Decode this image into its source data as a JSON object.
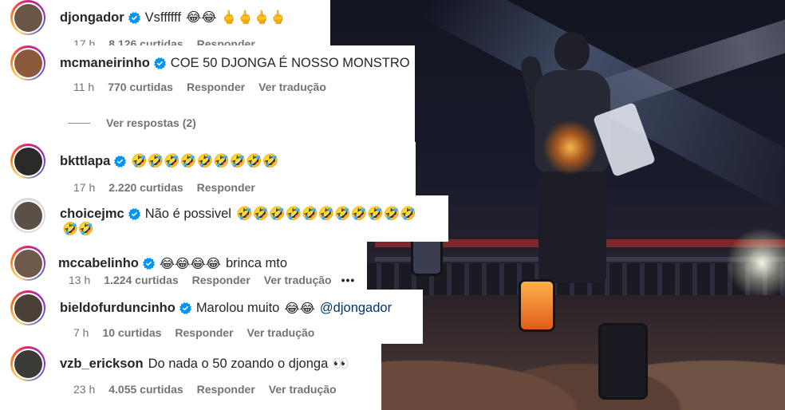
{
  "labels": {
    "reply": "Responder",
    "translate": "Ver tradução"
  },
  "comments": [
    {
      "username": "djongador",
      "text": "Vsffffff",
      "emojis": "😂😂 🖕🖕🖕🖕",
      "time": "17 h",
      "likes": "8.126 curtidas",
      "avatar_color": "#6b5646"
    },
    {
      "username": "mcmaneirinho",
      "text": "COE 50 DJONGA É NOSSO MONSTRO",
      "time": "11 h",
      "likes": "770 curtidas",
      "view_replies": "Ver respostas (2)",
      "avatar_color": "#8a5a3a"
    },
    {
      "username": "bkttlapa",
      "text": "",
      "emojis": "🤣🤣🤣🤣🤣🤣🤣🤣🤣",
      "time": "17 h",
      "likes": "2.220 curtidas",
      "avatar_color": "#2a2a2a"
    },
    {
      "username": "choicejmc",
      "text": "Não é possivel",
      "emojis": "🤣🤣🤣🤣🤣🤣🤣🤣🤣🤣🤣",
      "emojis_line2": "🤣🤣",
      "avatar_color": "#5a5048"
    },
    {
      "username": "mccabelinho",
      "emojis": "😂😂😂😂",
      "text": "brinca mto",
      "time": "13 h",
      "likes": "1.224 curtidas",
      "more": "•••",
      "avatar_color": "#6e5a4a"
    },
    {
      "username": "bieldofurduncinho",
      "text": "Marolou muito",
      "emojis": "😂😂",
      "mention": "@djongador",
      "time": "7 h",
      "likes": "10 curtidas",
      "avatar_color": "#4a4038"
    },
    {
      "username": "vzb_erickson",
      "text": "Do nada o 50 zoando o djonga",
      "emojis": "👀",
      "time": "23 h",
      "likes": "4.055 curtidas",
      "avatar_color": "#3c3a36"
    }
  ],
  "colors": {
    "verified": "#0095f6",
    "username": "#262626",
    "meta": "#737373",
    "mention": "#00376b"
  }
}
